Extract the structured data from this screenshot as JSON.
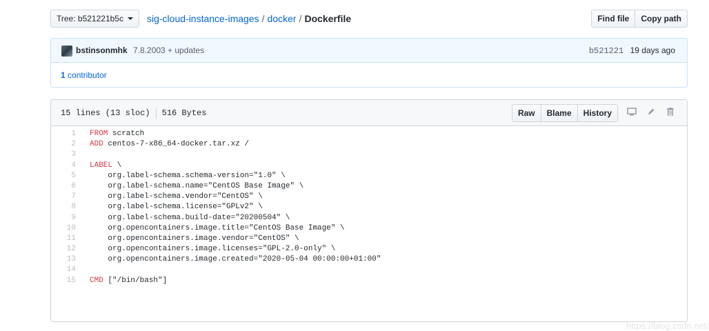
{
  "topbar": {
    "branch_label": "Tree: b521221b5c",
    "repo": "sig-cloud-instance-images",
    "folder": "docker",
    "file": "Dockerfile",
    "sep1": "/",
    "sep2": "/",
    "find_file": "Find file",
    "copy_path": "Copy path"
  },
  "commit": {
    "author": "bstinsonmhk",
    "message": "7.8.2003 + updates",
    "sha": "b521221",
    "when": "19 days ago"
  },
  "contributors": {
    "count": "1",
    "label": "contributor"
  },
  "file": {
    "lines_info": "15 lines (13 sloc)",
    "size": "516 Bytes",
    "raw": "Raw",
    "blame": "Blame",
    "history": "History",
    "icons": [
      "desktop-icon",
      "pencil-icon",
      "trash-icon"
    ]
  },
  "code_lines": [
    {
      "n": "1",
      "kw": "FROM",
      "rest": " scratch"
    },
    {
      "n": "2",
      "kw": "ADD",
      "rest": " centos-7-x86_64-docker.tar.xz /"
    },
    {
      "n": "3",
      "kw": "",
      "rest": ""
    },
    {
      "n": "4",
      "kw": "LABEL",
      "rest": " \\"
    },
    {
      "n": "5",
      "kw": "",
      "rest": "    org.label-schema.schema-version=\"1.0\" \\"
    },
    {
      "n": "6",
      "kw": "",
      "rest": "    org.label-schema.name=\"CentOS Base Image\" \\"
    },
    {
      "n": "7",
      "kw": "",
      "rest": "    org.label-schema.vendor=\"CentOS\" \\"
    },
    {
      "n": "8",
      "kw": "",
      "rest": "    org.label-schema.license=\"GPLv2\" \\"
    },
    {
      "n": "9",
      "kw": "",
      "rest": "    org.label-schema.build-date=\"20200504\" \\"
    },
    {
      "n": "10",
      "kw": "",
      "rest": "    org.opencontainers.image.title=\"CentOS Base Image\" \\"
    },
    {
      "n": "11",
      "kw": "",
      "rest": "    org.opencontainers.image.vendor=\"CentOS\" \\"
    },
    {
      "n": "12",
      "kw": "",
      "rest": "    org.opencontainers.image.licenses=\"GPL-2.0-only\" \\"
    },
    {
      "n": "13",
      "kw": "",
      "rest": "    org.opencontainers.image.created=\"2020-05-04 00:00:00+01:00\""
    },
    {
      "n": "14",
      "kw": "",
      "rest": ""
    },
    {
      "n": "15",
      "kw": "CMD",
      "rest": " [\"/bin/bash\"]"
    }
  ],
  "watermark": "https://blog.csdn.net/",
  "colors": {
    "link": "#0366d6",
    "keyword": "#d73a49",
    "commit_bg": "#f1f8ff"
  }
}
